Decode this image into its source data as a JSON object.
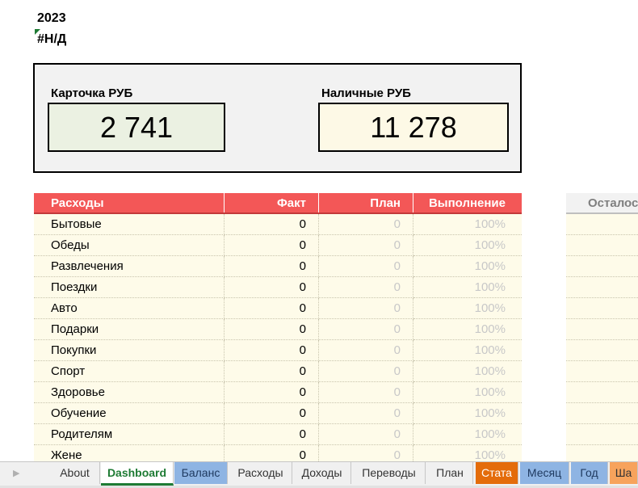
{
  "header": {
    "year": "2023",
    "error_value": "#Н/Д"
  },
  "summary": {
    "card_label": "Карточка РУБ",
    "card_value": "2 741",
    "cash_label": "Наличные РУБ",
    "cash_value": "11 278",
    "colors": {
      "card_bg": "#ebf1e2",
      "cash_bg": "#fdf9e6"
    }
  },
  "expenses": {
    "header": {
      "name": "Расходы",
      "fact": "Факт",
      "plan": "План",
      "done": "Выполнение"
    },
    "accent_color": "#f35757",
    "rows": [
      {
        "name": "Бытовые",
        "fact": "0",
        "plan": "0",
        "done": "100%"
      },
      {
        "name": "Обеды",
        "fact": "0",
        "plan": "0",
        "done": "100%"
      },
      {
        "name": "Развлечения",
        "fact": "0",
        "plan": "0",
        "done": "100%"
      },
      {
        "name": "Поездки",
        "fact": "0",
        "plan": "0",
        "done": "100%"
      },
      {
        "name": "Авто",
        "fact": "0",
        "plan": "0",
        "done": "100%"
      },
      {
        "name": "Подарки",
        "fact": "0",
        "plan": "0",
        "done": "100%"
      },
      {
        "name": "Покупки",
        "fact": "0",
        "plan": "0",
        "done": "100%"
      },
      {
        "name": "Спорт",
        "fact": "0",
        "plan": "0",
        "done": "100%"
      },
      {
        "name": "Здоровье",
        "fact": "0",
        "plan": "0",
        "done": "100%"
      },
      {
        "name": "Обучение",
        "fact": "0",
        "plan": "0",
        "done": "100%"
      },
      {
        "name": "Родителям",
        "fact": "0",
        "plan": "0",
        "done": "100%"
      },
      {
        "name": "Жене",
        "fact": "0",
        "plan": "0",
        "done": "100%"
      }
    ]
  },
  "remaining": {
    "header": "Осталос"
  },
  "tabs": {
    "nav_icon": "triangle-right-icon",
    "items": [
      {
        "label": "About",
        "style": "plain"
      },
      {
        "label": "Dashboard",
        "style": "active"
      },
      {
        "label": "Баланс",
        "style": "blue"
      },
      {
        "label": "Расходы",
        "style": "plain"
      },
      {
        "label": "Доходы",
        "style": "plain"
      },
      {
        "label": "Переводы",
        "style": "plain"
      },
      {
        "label": "План",
        "style": "plain"
      },
      {
        "label": "Стата",
        "style": "orange"
      },
      {
        "label": "Месяц",
        "style": "blue"
      },
      {
        "label": "Год",
        "style": "blue"
      },
      {
        "label": "Ша",
        "style": "lightorange"
      }
    ]
  }
}
